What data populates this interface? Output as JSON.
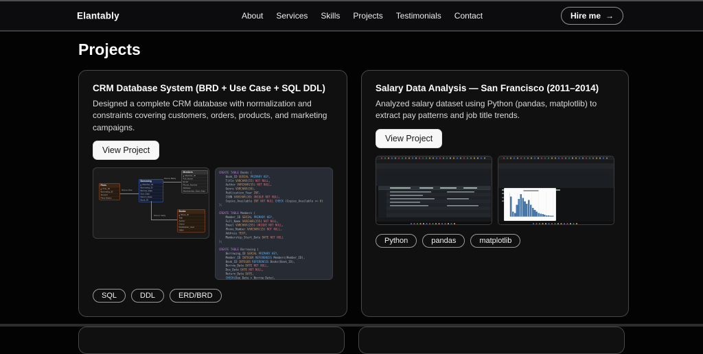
{
  "navbar": {
    "brand": "Elantably",
    "links": [
      "About",
      "Services",
      "Skills",
      "Projects",
      "Testimonials",
      "Contact"
    ],
    "hire": {
      "label": "Hire me",
      "arrow": "→"
    }
  },
  "page": {
    "title": "Projects"
  },
  "colors": {
    "accent_blue": "#3f6ed4",
    "card_bg": "#101010",
    "sql_bg": "#262b34",
    "histogram_bar": "#4878a8"
  },
  "cards": [
    {
      "title": "CRM Database System (BRD + Use Case + SQL DDL)",
      "description": "Designed a complete CRM database with normalization and constraints covering customers, orders, products, and marketing campaigns.",
      "button": "View Project",
      "tags": [
        "SQL",
        "DDL",
        "ERD/BRD"
      ],
      "erd": {
        "entities": [
          {
            "name": "Fines",
            "fields": [
              "Fine_ID",
              "Borrowing_ID",
              "Amount",
              "Paid_Status"
            ]
          },
          {
            "name": "Borrowing",
            "fields": [
              "Member_ID",
              "Borrowing_ID",
              "Borrow_Date",
              "Due_Date",
              "Return_Date",
              "Book_ID"
            ]
          },
          {
            "name": "Members",
            "fields": [
              "Member_ID",
              "Full_Name",
              "Email",
              "Phone_Number",
              "Address",
              "Membership_Start_Date"
            ]
          },
          {
            "name": "Books",
            "fields": [
              "Book_ID",
              "Title",
              "Author",
              "Genre",
              "Publication_Year",
              "ISBN"
            ]
          }
        ],
        "relations": [
          "One to One",
          "One to Many",
          "One to many"
        ]
      },
      "sql": "CREATE TABLE Books (\n    Book_ID SERIAL PRIMARY KEY,\n    Title VARCHAR(55) NOT NULL,\n    Author VARCHAR(55) NOT NULL,\n    Genre VARCHAR(50),\n    Publication_Year INT,\n    ISBN VARCHAR(20) UNIQUE NOT NULL,\n    Copies_Available INT NOT NULL CHECK (Copies_Available >= 0)\n);\n\nCREATE TABLE Members (\n    Member_ID SERIAL PRIMARY KEY,\n    Full_Name VARCHAR(255) NOT NULL,\n    Email VARCHAR(255) UNIQUE NOT NULL,\n    Phone_Number VARCHAR(15) NOT NULL,\n    Address TEXT,\n    Membership_Start_Date DATE NOT NULL\n);\n\nCREATE TABLE Borrowing (\n    Borrowing_ID SERIAL PRIMARY KEY,\n    Member_ID INTEGER REFERENCES Members(Member_ID),\n    Book_ID INTEGER REFERENCES Books(Book_ID),\n    Borrow_Date DATE NOT NULL,\n    Due_Date DATE NOT NULL,\n    Return_Date DATE,\n    CHECK(Due_Date > Borrow_Date),\n    CHECK(Return_Date IS NULL OR Return_Date >= Borrow_Date)\n);"
    },
    {
      "title": "Salary Data Analysis — San Francisco (2011–2014)",
      "description": "Analyzed salary dataset using Python (pandas, matplotlib) to extract pay patterns and job title trends.",
      "button": "View Project",
      "tags": [
        "Python",
        "pandas",
        "matplotlib"
      ],
      "histogram": {
        "values": [
          34,
          8,
          6,
          20,
          30,
          38,
          32,
          26,
          22,
          28,
          20,
          15,
          11,
          8,
          6,
          5,
          4,
          3,
          2,
          2,
          1,
          1
        ],
        "max": 40
      }
    }
  ]
}
